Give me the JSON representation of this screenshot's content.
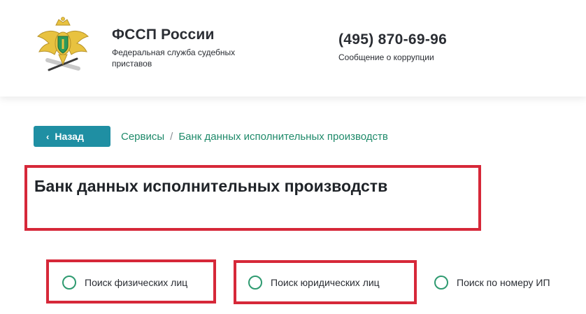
{
  "header": {
    "org_name": "ФССП России",
    "org_subtitle": "Федеральная служба судебных приставов",
    "phone": "(495) 870-69-96",
    "phone_subtitle": "Сообщение о коррупции",
    "emblem_icon": "coat-of-arms-icon"
  },
  "nav": {
    "back_label": "Назад",
    "back_icon": "chevron-left-icon",
    "breadcrumb": [
      "Сервисы",
      "Банк данных исполнительных производств"
    ],
    "breadcrumb_separator": "/"
  },
  "main": {
    "title": "Банк данных исполнительных производств",
    "search_options": [
      {
        "label": "Поиск физических лиц"
      },
      {
        "label": "Поиск юридических лиц"
      },
      {
        "label": "Поиск по номеру ИП"
      }
    ]
  },
  "colors": {
    "accent": "#1f8fa3",
    "link": "#1f8a6a",
    "highlight": "#d62839",
    "radio": "#2e9a70"
  }
}
